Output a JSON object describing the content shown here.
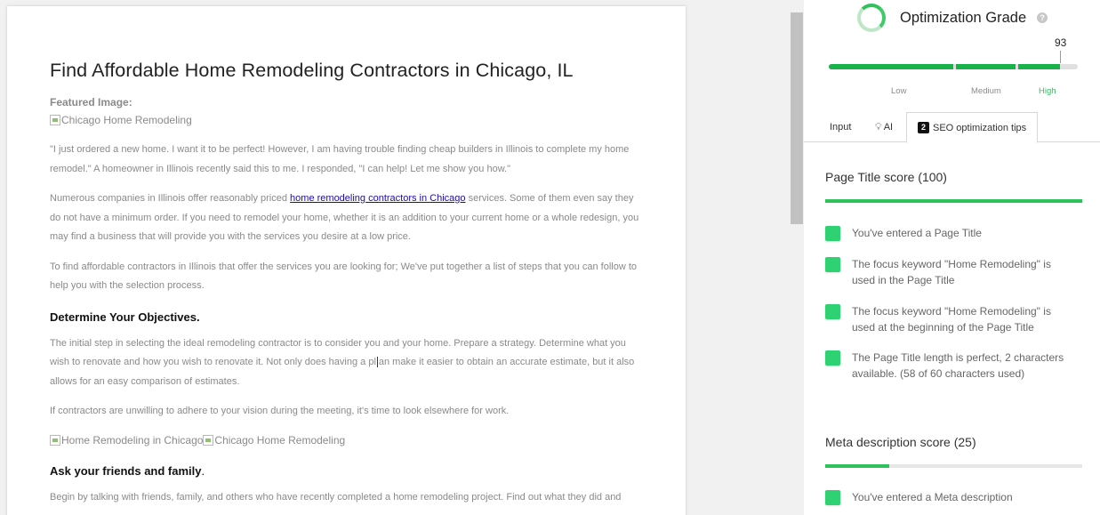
{
  "document": {
    "title": "Find Affordable Home Remodeling Contractors in Chicago, IL",
    "featured_image_label": "Featured Image:",
    "featured_image_alt": "Chicago Home Remodeling",
    "p1": "\"I just ordered a new home. I want it to be perfect! However, I am having trouble finding cheap builders in Illinois to complete my home remodel.\" A homeowner in Illinois recently said this to me. I responded, \"I can help! Let me show you how.\"",
    "p2_before": "Numerous companies in Illinois offer reasonably priced ",
    "p2_link": "home remodeling contractors in Chicago",
    "p2_after": " services. Some of them even say they do not have a minimum order. If you need to remodel your home, whether it is an addition to your current home or a whole redesign, you may find a business that will provide you with the services you desire at a low price.",
    "p3": "To find affordable contractors in Illinois that offer the services you are looking for; We've put together a list of steps that you can follow to help you with the selection process.",
    "h2_objectives": "Determine Your Objectives.",
    "p4_before": "The initial step in selecting the ideal remodeling contractor is to consider you and your home. Prepare a strategy. Determine what you wish to renovate and how you wish to renovate it. Not only does having a pl",
    "p4_after": "an make it easier to obtain an accurate estimate, but it also allows for an easy comparison of estimates.",
    "p5": "If contractors are unwilling to adhere to your vision during the meeting, it's time to look elsewhere for work.",
    "img_alt_1": "Home Remodeling in Chicago",
    "img_alt_2": "Chicago Home Remodeling",
    "h2_friends": "Ask your friends and family",
    "h2_friends_tail": ".",
    "p6": "Begin by talking with friends, family, and others who have recently completed a home remodeling project. Find out what they did and"
  },
  "panel": {
    "grade_title": "Optimization Grade",
    "help_icon": "?",
    "grade_value": "93",
    "grade_fraction": 0.93,
    "levels": {
      "low": "Low",
      "medium": "Medium",
      "high": "High"
    },
    "tabs": {
      "input": "Input",
      "ai": "AI",
      "seo_badge": "2",
      "seo": "SEO optimization tips"
    },
    "page_title_section": {
      "title": "Page Title score (100)",
      "score": 100,
      "checks": [
        "You've entered a Page Title",
        "The focus keyword \"Home Remodeling\" is used in the Page Title",
        "The focus keyword \"Home Remodeling\" is used at the beginning of the Page Title",
        "The Page Title length is perfect, 2 characters available. (58 of 60 characters used)"
      ]
    },
    "meta_section": {
      "title": "Meta description score (25)",
      "score": 25,
      "checks": [
        "You've entered a Meta description"
      ]
    },
    "colors": {
      "accent_green": "#2fc15a",
      "check_green": "#2ed273",
      "link_blue": "#1a0dab"
    }
  }
}
